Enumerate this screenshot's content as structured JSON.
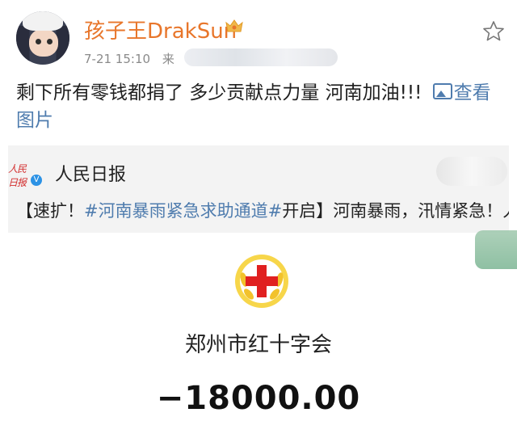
{
  "post": {
    "username": "孩子王DrakSun",
    "time": "7-21 15:10",
    "source_prefix": "来",
    "text": "剩下所有零钱都捐了 多少贡献点力量 河南加油!!!",
    "view_image": "查看图片",
    "vip_icon": "crown-icon",
    "star_icon": "star-outline-icon"
  },
  "repost": {
    "author": "人民日报",
    "logo_text": "人民日报",
    "text_prefix": "【速扩！",
    "hashtag": "#河南暴雨紧急求助通道#",
    "text_suffix": "开启】河南暴雨，汛情紧急！人民日报新媒体开通“河南暴雨紧急求助通道”，如果您"
  },
  "receipt": {
    "org": "郑州市红十字会",
    "amount": "−18000.00",
    "emblem_colors": {
      "red": "#e02020",
      "gold": "#f2c22b"
    }
  }
}
